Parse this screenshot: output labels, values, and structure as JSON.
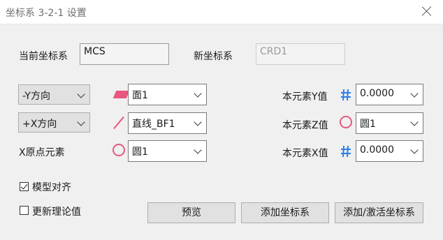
{
  "window": {
    "title": "坐标系 3-2-1 设置"
  },
  "current_cs": {
    "label": "当前坐标系",
    "value": "MCS"
  },
  "new_cs": {
    "label": "新坐标系",
    "value": "CRD1"
  },
  "rows": {
    "r1": {
      "direction": "-Y方向",
      "element": "面1",
      "element_icon": "plane-face-icon",
      "right_label": "本元素Y值",
      "right_icon": "hash-icon",
      "right_value": "0.0000"
    },
    "r2": {
      "direction": "+X方向",
      "element": "直线_BF1",
      "element_icon": "line-icon",
      "right_label": "本元素Z值",
      "right_icon": "circle-icon",
      "right_value": "圆1"
    },
    "r3": {
      "label": "X原点元素",
      "element": "圆1",
      "element_icon": "circle-icon",
      "right_label": "本元素X值",
      "right_icon": "hash-icon",
      "right_value": "0.0000"
    }
  },
  "checkboxes": {
    "model_align": {
      "label": "模型对齐",
      "checked": true
    },
    "update_theory": {
      "label": "更新理论值",
      "checked": false
    }
  },
  "buttons": {
    "preview": "预览",
    "add_cs": "添加坐标系",
    "add_activate_cs": "添加/激活坐标系"
  },
  "colors": {
    "icon_pink": "#e8577c",
    "icon_blue": "#2b7de9"
  }
}
